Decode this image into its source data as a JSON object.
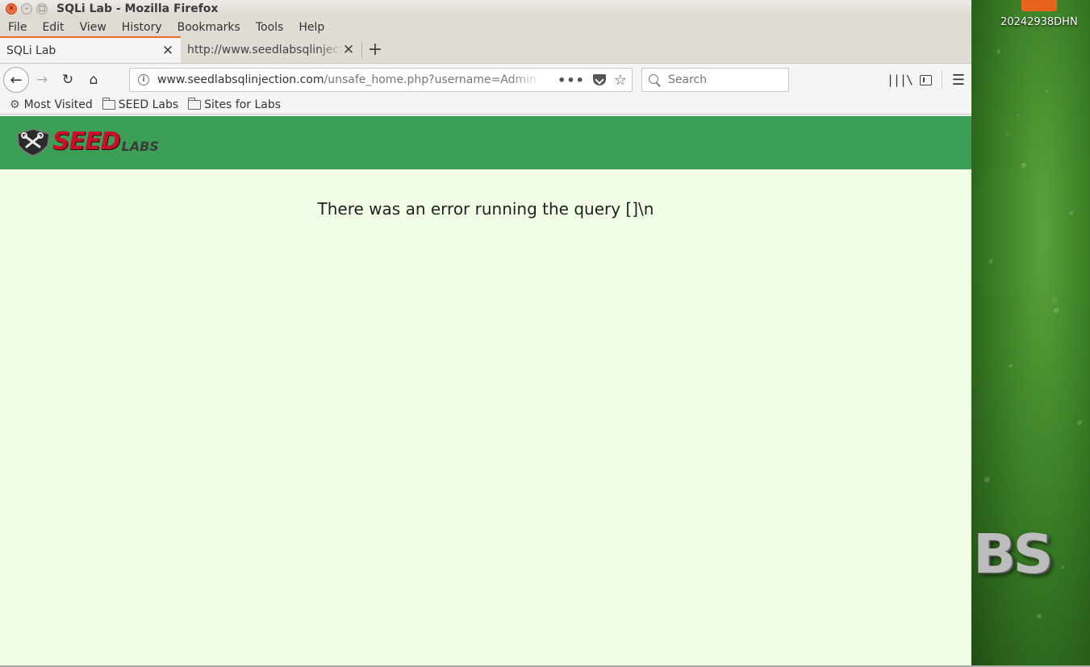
{
  "desktop": {
    "label": "20242938DHN"
  },
  "window": {
    "title": "SQLi Lab - Mozilla Firefox"
  },
  "menubar": {
    "items": [
      "File",
      "Edit",
      "View",
      "History",
      "Bookmarks",
      "Tools",
      "Help"
    ]
  },
  "tabs": [
    {
      "label": "SQLi Lab",
      "active": true
    },
    {
      "label": "http://www.seedlabsqlinjection.com/unsafe_home.php?username=Admin'",
      "active": false
    }
  ],
  "navbar": {
    "url_host": "www.seedlabsqlinjection.com",
    "url_path": "/unsafe_home.php?username=Admin'&Password=",
    "search_placeholder": "Search"
  },
  "bookmarks": [
    {
      "label": "Most Visited",
      "icon": "gear-icon"
    },
    {
      "label": "SEED Labs",
      "icon": "folder-icon"
    },
    {
      "label": "Sites for Labs",
      "icon": "folder-icon"
    }
  ],
  "page": {
    "logo_seed": "SEED",
    "logo_labs": "LABS",
    "error_message": "There was an error running the query []\\n"
  },
  "colors": {
    "header_green": "#3ba055",
    "page_bg": "#f2fde5",
    "tab_accent": "#e66c2c"
  }
}
